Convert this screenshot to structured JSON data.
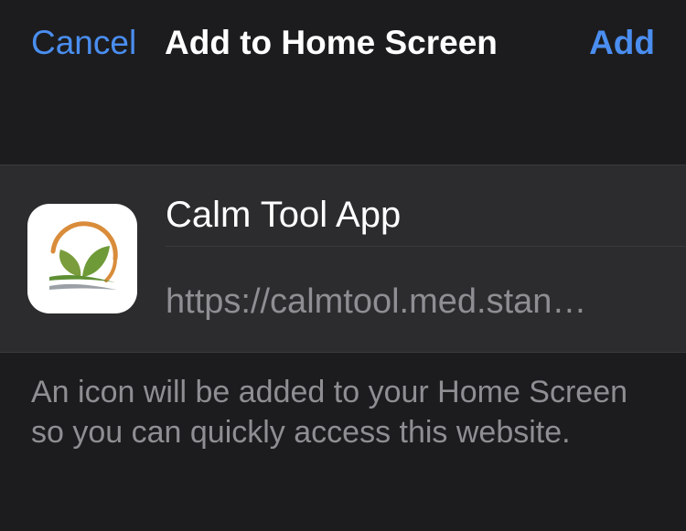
{
  "nav": {
    "cancel_label": "Cancel",
    "title": "Add to Home Screen",
    "add_label": "Add"
  },
  "app": {
    "name": "Calm Tool App",
    "url": "https://calmtool.med.stan…",
    "icon": "calm-tool-leaf-logo"
  },
  "note": "An icon will be added to your Home Screen so you can quickly access this website.",
  "colors": {
    "accent": "#4a8ef0",
    "background": "#1c1c1e",
    "card": "#2c2c2e",
    "secondary_text": "#8e8e93"
  }
}
